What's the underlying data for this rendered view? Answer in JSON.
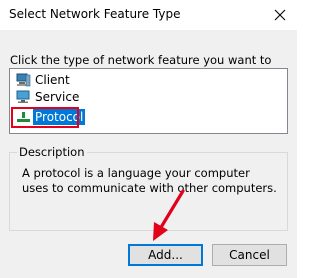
{
  "window": {
    "title": "Select Network Feature Type",
    "close_icon": "close-icon"
  },
  "instruction": "Click the type of network feature you want to install:",
  "features": [
    {
      "label": "Client",
      "icon": "client-icon",
      "selected": false
    },
    {
      "label": "Service",
      "icon": "service-icon",
      "selected": false
    },
    {
      "label": "Protocol",
      "icon": "protocol-icon",
      "selected": true
    }
  ],
  "description": {
    "heading": "Description",
    "text": "A protocol is a language your computer uses to communicate with other computers."
  },
  "buttons": {
    "add": "Add...",
    "cancel": "Cancel"
  },
  "annotation": {
    "highlight_color": "#e3001b",
    "arrow_color": "#e3001b"
  }
}
